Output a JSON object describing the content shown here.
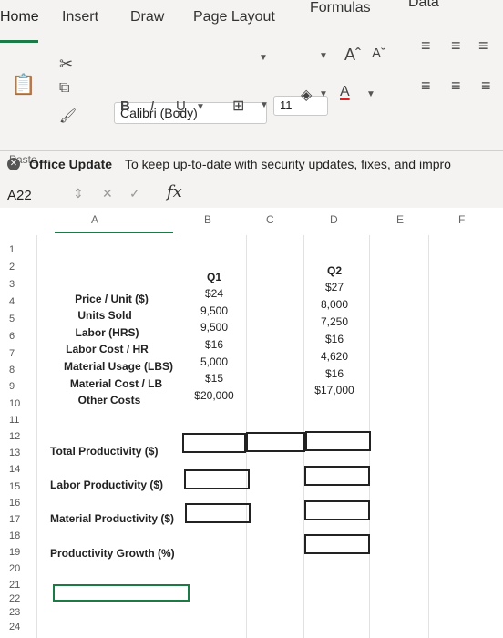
{
  "tabs": [
    "Home",
    "Insert",
    "Draw",
    "Page Layout",
    "Formulas",
    "Data"
  ],
  "ribbon": {
    "paste_label": "Paste",
    "font_name": "Calibri (Body)",
    "font_size": "11",
    "bold": "B",
    "italic": "I",
    "underline": "U"
  },
  "update": {
    "title": "Office Update",
    "message": "To keep up-to-date with security updates, fixes, and impro"
  },
  "formula_bar": {
    "name_box": "A22",
    "fx": "fx"
  },
  "columns": [
    "A",
    "B",
    "C",
    "D",
    "E",
    "F"
  ],
  "rows": [
    "1",
    "2",
    "3",
    "4",
    "5",
    "6",
    "7",
    "8",
    "9",
    "10",
    "11",
    "12",
    "13",
    "14",
    "15",
    "16",
    "17",
    "18",
    "19",
    "20",
    "21",
    "22",
    "23",
    "24"
  ],
  "headers": {
    "q1": "Q1",
    "q2": "Q2"
  },
  "table": [
    {
      "label": "Price / Unit ($)",
      "q1": "$24",
      "q2": "$27"
    },
    {
      "label": "Units Sold",
      "q1": "9,500",
      "q2": "8,000"
    },
    {
      "label": "Labor (HRS)",
      "q1": "9,500",
      "q2": "7,250"
    },
    {
      "label": "Labor Cost / HR",
      "q1": "$16",
      "q2": "$16"
    },
    {
      "label": "Material Usage (LBS)",
      "q1": "5,000",
      "q2": "4,620"
    },
    {
      "label": "Material Cost / LB",
      "q1": "$15",
      "q2": "$16"
    },
    {
      "label": "Other Costs",
      "q1": "$20,000",
      "q2": "$17,000"
    }
  ],
  "metrics": {
    "total": "Total Productivity ($)",
    "labor": "Labor Productivity ($)",
    "material": "Material Productivity ($)",
    "growth": "Productivity Growth (%)"
  },
  "accent_color": "#1b7a45"
}
